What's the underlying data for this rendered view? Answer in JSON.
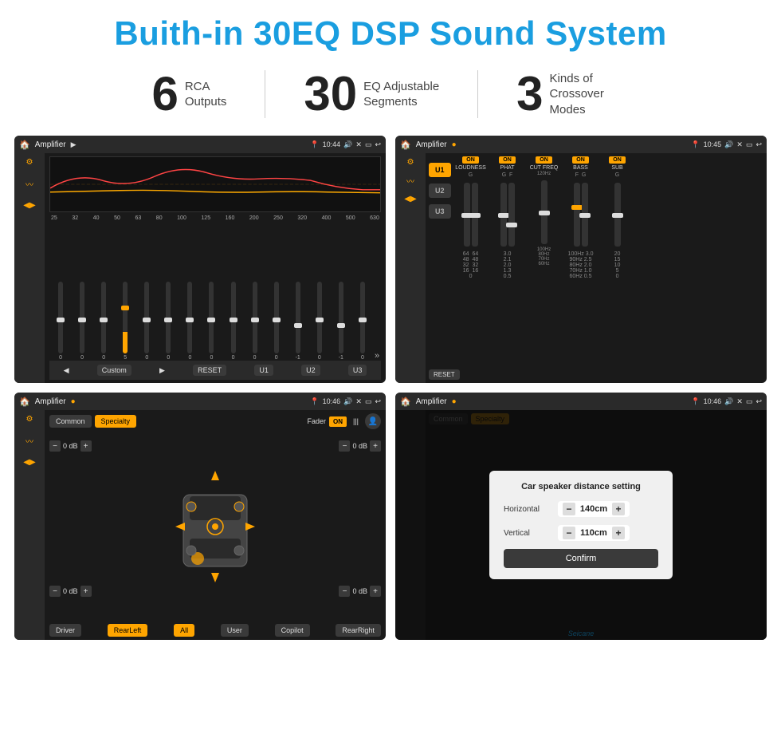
{
  "header": {
    "title": "Buith-in 30EQ DSP Sound System"
  },
  "stats": [
    {
      "number": "6",
      "label": "RCA\nOutputs"
    },
    {
      "number": "30",
      "label": "EQ Adjustable\nSegments"
    },
    {
      "number": "3",
      "label": "Kinds of\nCrossover Modes"
    }
  ],
  "screens": {
    "top_left": {
      "status_title": "Amplifier",
      "time": "10:44",
      "eq_frequencies": [
        "25",
        "32",
        "40",
        "50",
        "63",
        "80",
        "100",
        "125",
        "160",
        "200",
        "250",
        "320",
        "400",
        "500",
        "630"
      ],
      "eq_values": [
        "0",
        "0",
        "0",
        "5",
        "0",
        "0",
        "0",
        "0",
        "0",
        "0",
        "0",
        "-1",
        "0",
        "-1",
        "0"
      ],
      "bottom_buttons": [
        "Custom",
        "RESET",
        "U1",
        "U2",
        "U3"
      ]
    },
    "top_right": {
      "status_title": "Amplifier",
      "time": "10:45",
      "u_buttons": [
        "U1",
        "U2",
        "U3"
      ],
      "controls": [
        "LOUDNESS",
        "PHAT",
        "CUT FREQ",
        "BASS",
        "SUB"
      ],
      "reset_label": "RESET"
    },
    "bottom_left": {
      "status_title": "Amplifier",
      "time": "10:46",
      "tabs": [
        "Common",
        "Specialty"
      ],
      "fader_label": "Fader",
      "db_values": [
        "0 dB",
        "0 dB",
        "0 dB",
        "0 dB"
      ],
      "buttons": [
        "Driver",
        "RearLeft",
        "All",
        "User",
        "Copilot",
        "RearRight"
      ]
    },
    "bottom_right": {
      "status_title": "Amplifier",
      "time": "10:46",
      "dialog": {
        "title": "Car speaker distance setting",
        "horizontal_label": "Horizontal",
        "horizontal_value": "140cm",
        "vertical_label": "Vertical",
        "vertical_value": "110cm",
        "confirm_label": "Confirm"
      }
    }
  },
  "watermark": "Seicane"
}
